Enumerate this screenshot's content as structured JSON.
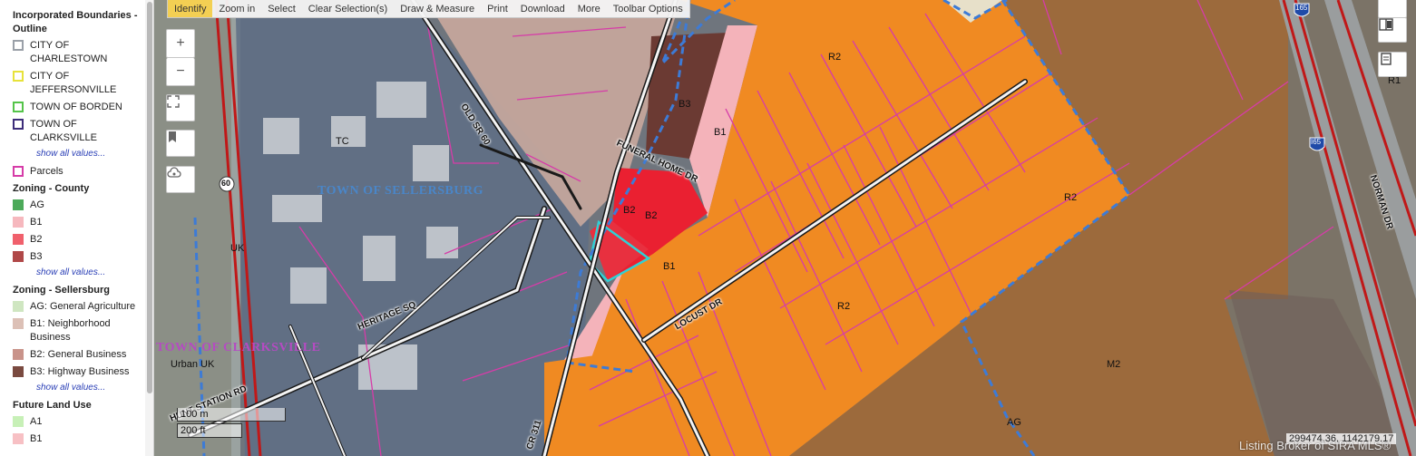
{
  "legend": {
    "sections": [
      {
        "title": "Incorporated Boundaries - Outline",
        "items": [
          {
            "label": "CITY OF CHARLESTOWN",
            "color": "#9aa0a8",
            "style": "dash"
          },
          {
            "label": "CITY OF JEFFERSONVILLE",
            "color": "#e7e23a",
            "style": "dash"
          },
          {
            "label": "TOWN OF BORDEN",
            "color": "#55c44a",
            "style": "dash"
          },
          {
            "label": "TOWN OF CLARKSVILLE",
            "color": "#3d2d7a",
            "style": "dash"
          }
        ],
        "more": "show all values..."
      },
      {
        "title": "",
        "items": [
          {
            "label": "Parcels",
            "color": "#d63ca8",
            "style": "outline"
          }
        ],
        "more": ""
      },
      {
        "title": "Zoning - County",
        "items": [
          {
            "label": "AG",
            "color": "#4caa5a",
            "style": "fill"
          },
          {
            "label": "B1",
            "color": "#f6b8be",
            "style": "fill"
          },
          {
            "label": "B2",
            "color": "#f0606c",
            "style": "fill"
          },
          {
            "label": "B3",
            "color": "#b04848",
            "style": "fill"
          }
        ],
        "more": "show all values..."
      },
      {
        "title": "Zoning - Sellersburg",
        "items": [
          {
            "label": "AG: General Agriculture",
            "color": "#cfe6c1",
            "style": "fill"
          },
          {
            "label": "B1: Neighborhood Business",
            "color": "#dcc0b6",
            "style": "fill"
          },
          {
            "label": "B2: General Business",
            "color": "#c9938a",
            "style": "fill"
          },
          {
            "label": "B3: Highway Business",
            "color": "#7a4a40",
            "style": "fill"
          }
        ],
        "more": "show all values..."
      },
      {
        "title": "Future Land Use",
        "items": [
          {
            "label": "A1",
            "color": "#c7f0b7",
            "style": "fill"
          },
          {
            "label": "B1",
            "color": "#f7c0c4",
            "style": "fill"
          }
        ],
        "more": ""
      }
    ]
  },
  "toolbar": {
    "buttons": [
      "Identify",
      "Zoom in",
      "Select",
      "Clear Selection(s)",
      "Draw & Measure",
      "Print",
      "Download",
      "More",
      "Toolbar Options"
    ],
    "active": "Identify"
  },
  "map": {
    "town_labels": {
      "sellersburg": "TOWN OF SELLERSBURG",
      "clarksville": "TOWN OF CLARKSVILLE"
    },
    "zone_labels": {
      "r2_top": "R2",
      "r2_right": "R2",
      "r2_mid": "R2",
      "b3": "B3",
      "b1_upper": "B1",
      "b2_a": "B2",
      "b2_b": "B2",
      "b1_lower": "B1",
      "tc": "TC",
      "uk": "UK",
      "urban_uk": "Urban UK",
      "m2": "M2",
      "ag": "AG",
      "r1": "R1"
    },
    "road_labels": {
      "old_sr60": "OLD SR 60",
      "funeral_home_dr": "FUNERAL HOME DR",
      "locust_dr": "LOCUST DR",
      "heritage_sq": "HERITAGE SQ",
      "station_rd": "HUNT STATION RD",
      "cr311": "CR 311",
      "norman_dr": "NORMAN DR"
    },
    "shields": {
      "sr60": "60",
      "i65_top": "165",
      "i65_mid": "I65"
    },
    "scale": {
      "metric": "100 m",
      "imperial": "200 ft"
    },
    "coordinates": "299474.36, 1142179.17",
    "watermark": "Listing Broker of SIRA MLS®"
  }
}
